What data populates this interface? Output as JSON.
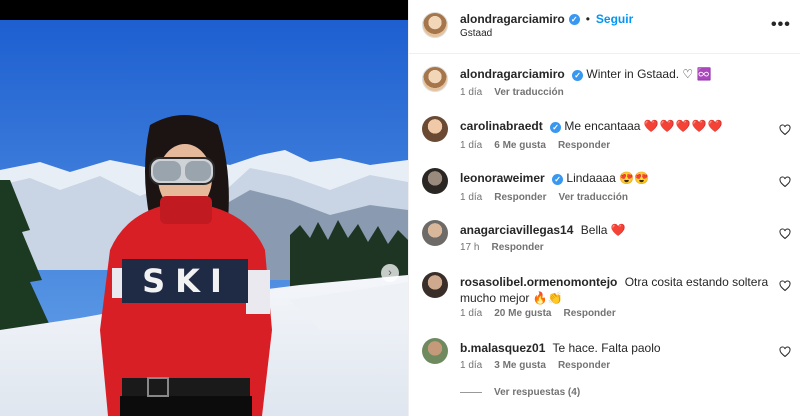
{
  "post": {
    "author": "alondragarciamiro",
    "follow_label": "Seguir",
    "location": "Gstaad",
    "caption": "Winter in Gstaad. ♡ ♾️",
    "caption_time": "1 día",
    "caption_translate": "Ver traducción"
  },
  "photo": {
    "sweater_text": "SKI"
  },
  "comments": [
    {
      "user": "carolinabraedt",
      "verified": true,
      "text": "Me encantaaa",
      "emoji": "❤️❤️❤️❤️❤️",
      "time": "1 día",
      "likes": "6 Me gusta",
      "reply": "Responder",
      "translate": ""
    },
    {
      "user": "leonoraweimer",
      "verified": true,
      "text": "Lindaaaa",
      "emoji": "😍😍",
      "time": "1 día",
      "likes": "",
      "reply": "Responder",
      "translate": "Ver traducción"
    },
    {
      "user": "anagarciavillegas14",
      "verified": false,
      "text": "Bella",
      "emoji": "❤️",
      "time": "17 h",
      "likes": "",
      "reply": "Responder",
      "translate": ""
    },
    {
      "user": "rosasolibel.ormenomontejo",
      "verified": false,
      "text": "Otra cosita estando soltera mucho mejor",
      "emoji": "🔥👏",
      "time": "1 día",
      "likes": "20 Me gusta",
      "reply": "Responder",
      "translate": ""
    },
    {
      "user": "b.malasquez01",
      "verified": false,
      "text": "Te hace. Falta paolo",
      "emoji": "",
      "time": "1 día",
      "likes": "3 Me gusta",
      "reply": "Responder",
      "translate": ""
    }
  ],
  "view_replies": "Ver respuestas (4)",
  "icons": {
    "verified": "verified-badge-icon",
    "more": "more-options-icon",
    "heart": "heart-outline-icon",
    "next": "chevron-right-icon"
  },
  "colors": {
    "accent": "#0095f6",
    "verified": "#3897f0",
    "heart_red": "#e0192f"
  }
}
